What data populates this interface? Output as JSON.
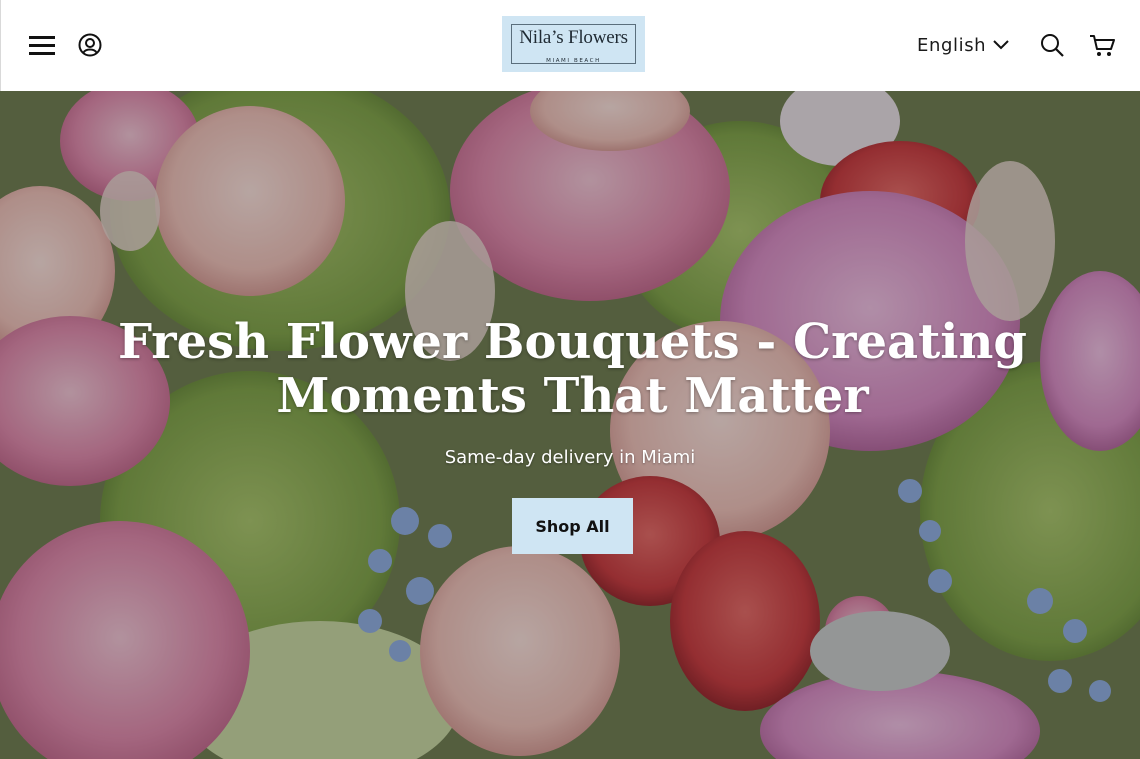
{
  "header": {
    "logo_name": "Nila’s Flowers",
    "logo_location": "MIAMI BEACH",
    "language": "English",
    "icons": {
      "menu": "hamburger-menu-icon",
      "account": "user-account-icon",
      "language_dropdown": "chevron-down-icon",
      "search": "search-icon",
      "cart": "shopping-cart-icon"
    }
  },
  "hero": {
    "title": "Fresh Flower Bouquets - Creating Moments That Matter",
    "subtitle": "Same-day delivery in Miami",
    "cta_label": "Shop All"
  },
  "colors": {
    "brand_light_blue": "#cfe5f3",
    "text_dark": "#1b1b1b",
    "hero_text": "#ffffff"
  }
}
